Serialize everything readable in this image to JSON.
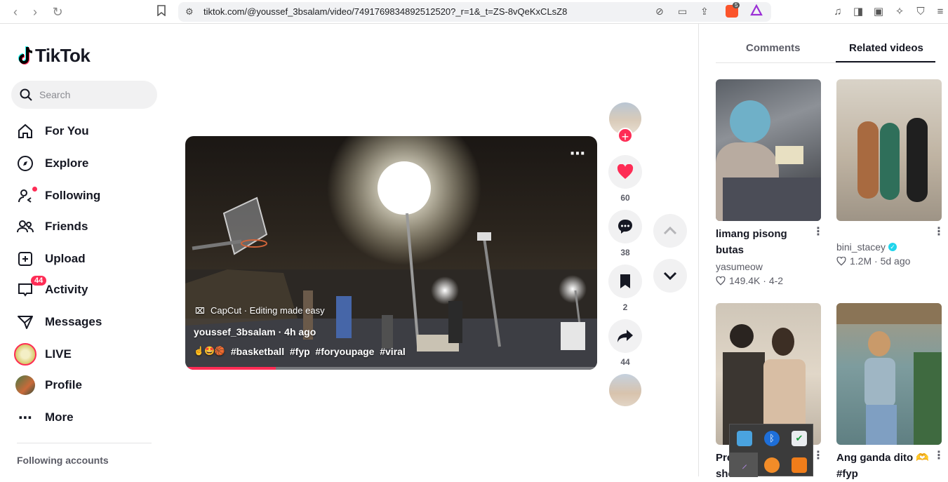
{
  "browser": {
    "url": "tiktok.com/@youssef_3bsalam/video/7491769834892512520?_r=1&_t=ZS-8vQeKxCLsZ8",
    "extension_badge": "5"
  },
  "sidebar": {
    "logo_text": "TikTok",
    "search_placeholder": "Search",
    "items": [
      {
        "label": "For You"
      },
      {
        "label": "Explore"
      },
      {
        "label": "Following"
      },
      {
        "label": "Friends"
      },
      {
        "label": "Upload"
      },
      {
        "label": "Activity",
        "badge": "44"
      },
      {
        "label": "Messages"
      },
      {
        "label": "LIVE"
      },
      {
        "label": "Profile"
      },
      {
        "label": "More"
      }
    ],
    "following_accounts": "Following accounts"
  },
  "video": {
    "capcut_label": "CapCut · Editing made easy",
    "author_line": "youssef_3bsalam · 4h ago",
    "emojis": "☝️🤩🏀",
    "hashtags": "#basketball  #fyp  #foryoupage  #viral",
    "progress": 0.22,
    "likes": "60",
    "comments": "38",
    "saves": "2",
    "shares": "44"
  },
  "panel": {
    "tabs": [
      "Comments",
      "Related videos"
    ],
    "active_tab": "Related videos",
    "related": [
      {
        "title_line1": "limang pisong",
        "title_line2": "butas",
        "author": "yasumeow",
        "stats": "149.4K · 4-2",
        "verified": false
      },
      {
        "title_line1": "",
        "title_line2": "",
        "author": "bini_stacey",
        "stats": "1.2M · 5d ago",
        "verified": true
      },
      {
        "title_line1": "Pre",
        "title_line2": "she",
        "author": "",
        "stats": "",
        "verified": false
      },
      {
        "title_line1": "Ang ganda dito 🫶",
        "title_line2": "#fyp",
        "author": "",
        "stats": "",
        "verified": false
      }
    ]
  },
  "colors": {
    "accent": "#fe2c55",
    "verified": "#20d5ec"
  }
}
